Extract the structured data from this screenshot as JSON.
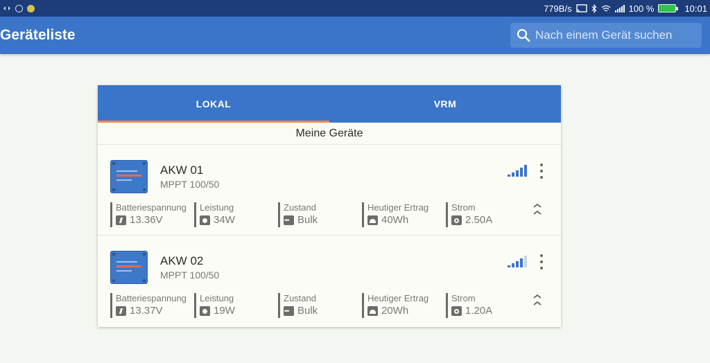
{
  "statusbar": {
    "icons_left": [
      "dev-options-icon",
      "usb-debug-icon",
      "sun-icon"
    ],
    "network_speed": "779B/s",
    "battery_percent": "100 %",
    "time": "10:01"
  },
  "appbar": {
    "title": "Geräteliste",
    "search_placeholder": "Nach einem Gerät suchen"
  },
  "tabs": [
    {
      "label": "LOKAL",
      "active": true
    },
    {
      "label": "VRM",
      "active": false
    }
  ],
  "section": {
    "title": "Meine Geräte"
  },
  "devices": [
    {
      "name": "AKW 01",
      "model": "MPPT 100/50",
      "signal_bars": 5,
      "stats": [
        {
          "label": "Batteriespannung",
          "value": "13.36V",
          "icon": "battery-icon"
        },
        {
          "label": "Leistung",
          "value": "34W",
          "icon": "power-icon"
        },
        {
          "label": "Zustand",
          "value": "Bulk",
          "icon": "state-icon"
        },
        {
          "label": "Heutiger Ertrag",
          "value": "40Wh",
          "icon": "yield-icon"
        },
        {
          "label": "Strom",
          "value": "2.50A",
          "icon": "current-icon"
        }
      ]
    },
    {
      "name": "AKW 02",
      "model": "MPPT 100/50",
      "signal_bars": 4,
      "stats": [
        {
          "label": "Batteriespannung",
          "value": "13.37V",
          "icon": "battery-icon"
        },
        {
          "label": "Leistung",
          "value": "19W",
          "icon": "power-icon"
        },
        {
          "label": "Zustand",
          "value": "Bulk",
          "icon": "state-icon"
        },
        {
          "label": "Heutiger Ertrag",
          "value": "20Wh",
          "icon": "yield-icon"
        },
        {
          "label": "Strom",
          "value": "1.20A",
          "icon": "current-icon"
        }
      ]
    }
  ],
  "colors": {
    "primary": "#3b75c9",
    "statusbar": "#1c3d7a",
    "tab_indicator": "#f0894a",
    "signal_active": "#3b75c9",
    "signal_inactive": "#c9d3df"
  }
}
